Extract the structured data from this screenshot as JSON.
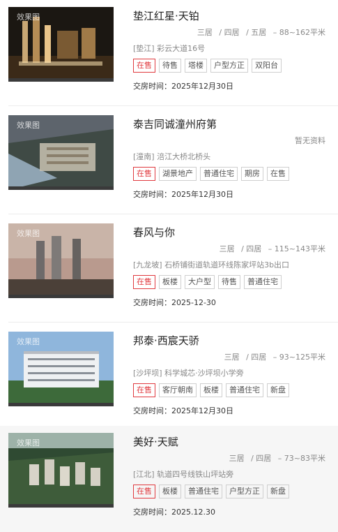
{
  "listings": [
    {
      "title": "垫江红星·天铂",
      "meta": [
        "三居",
        "/ 四居",
        "/ 五居",
        "– 88~162平米"
      ],
      "address": "[垫江] 彩云大道16号",
      "tags": [
        "在售",
        "待售",
        "塔楼",
        "户型方正",
        "双阳台"
      ],
      "delivery": "交房时间：2025年12月30日",
      "watermark": "效果图",
      "image": "night-aerial-rendering"
    },
    {
      "title": "泰吉同诚潼州府第",
      "meta": [
        "暂无资料"
      ],
      "address": "[潼南] 涪江大桥北桥头",
      "tags": [
        "在售",
        "湖景地产",
        "普通住宅",
        "期房",
        "在售"
      ],
      "delivery": "交房时间：2025年12月30日",
      "watermark": "效果图",
      "image": "riverside-aerial-rendering"
    },
    {
      "title": "春风与你",
      "meta": [
        "三居",
        "/ 四居",
        "– 115~143平米"
      ],
      "address": "[九龙坡] 石桥铺街道轨道环线陈家坪站3b出口",
      "tags": [
        "在售",
        "板楼",
        "大户型",
        "待售",
        "普通住宅"
      ],
      "delivery": "交房时间：2025-12-30",
      "watermark": "效果图",
      "image": "towers-dusk-rendering"
    },
    {
      "title": "邦泰·西宸天骄",
      "meta": [
        "三居",
        "/ 四居",
        "– 93~125平米"
      ],
      "address": "[沙坪坝] 科学城芯·沙坪坝小学旁",
      "tags": [
        "在售",
        "客厅朝南",
        "板楼",
        "普通住宅",
        "新盘"
      ],
      "delivery": "交房时间：2025年12月30日",
      "watermark": "效果图",
      "image": "white-building-rendering"
    },
    {
      "title": "美好·天赋",
      "meta": [
        "三居",
        "/ 四居",
        "– 73~83平米"
      ],
      "address": "[江北] 轨道四号线铁山坪站旁",
      "tags": [
        "在售",
        "板楼",
        "普通住宅",
        "户型方正",
        "新盘"
      ],
      "delivery": "交房时间：2025.12.30",
      "watermark": "效果图",
      "image": "green-aerial-rendering"
    }
  ],
  "colors": {
    "accent_red": "#e0393e",
    "tag_border": "#cfcfcf",
    "muted_text": "#888888"
  }
}
